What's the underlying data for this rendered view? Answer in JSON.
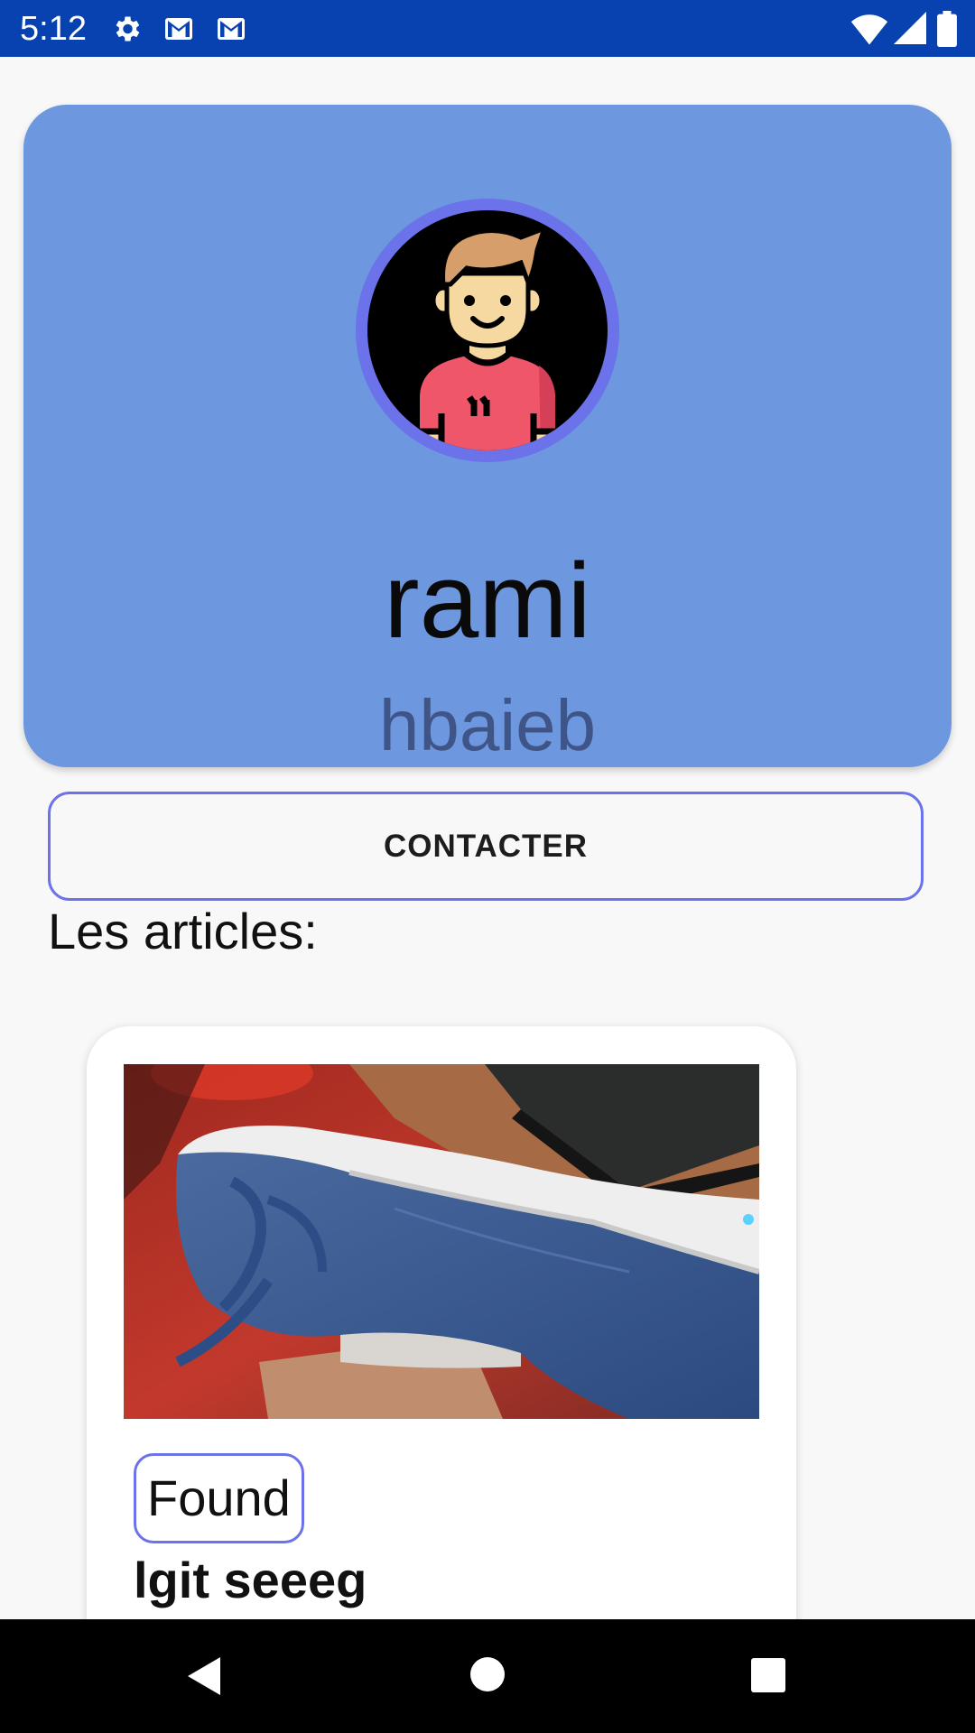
{
  "status_bar": {
    "time": "5:12",
    "icons_left": [
      "gear-icon",
      "gmail-icon",
      "gmail-icon"
    ],
    "icons_right": [
      "wifi-icon",
      "signal-icon",
      "battery-icon"
    ],
    "background": "#0742b0"
  },
  "profile": {
    "first_name": "rami",
    "last_name": "hbaieb",
    "card_color": "#6d97df",
    "avatar_ring_color": "#6b72ea"
  },
  "contact_button": {
    "label": "CONTACTER"
  },
  "articles_section": {
    "title": "Les articles:",
    "items": [
      {
        "status": "Found",
        "title": "lgit seeeg",
        "image": "blue-sneaker-photo"
      }
    ]
  },
  "nav_bar": {
    "buttons": [
      "back-icon",
      "home-icon",
      "recents-icon"
    ]
  }
}
